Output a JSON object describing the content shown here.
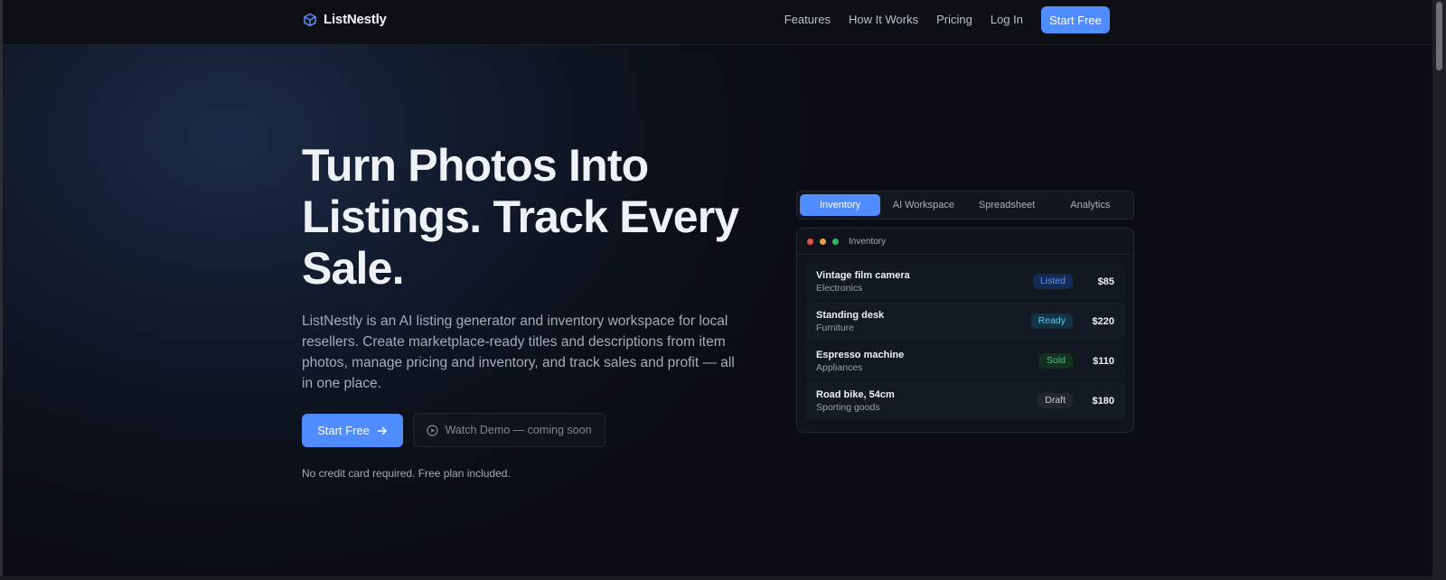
{
  "nav": {
    "brand": "ListNestly",
    "links": [
      "Features",
      "How It Works",
      "Pricing",
      "Log In"
    ],
    "cta": "Start Free"
  },
  "hero": {
    "title": "Turn Photos Into Listings. Track Every Sale.",
    "description": "ListNestly is an AI listing generator and inventory workspace for local resellers. Create marketplace-ready titles and descriptions from item photos, manage pricing and inventory, and track sales and profit — all in one place.",
    "primary_cta": "Start Free",
    "secondary_cta": "Watch Demo — coming soon",
    "note": "No credit card required. Free plan included."
  },
  "preview": {
    "tabs": [
      {
        "label": "Inventory",
        "active": true
      },
      {
        "label": "AI Workspace",
        "active": false
      },
      {
        "label": "Spreadsheet",
        "active": false
      },
      {
        "label": "Analytics",
        "active": false
      }
    ],
    "window_title": "Inventory",
    "items": [
      {
        "name": "Vintage film camera",
        "category": "Electronics",
        "status": "Listed",
        "price": "$85"
      },
      {
        "name": "Standing desk",
        "category": "Furniture",
        "status": "Ready",
        "price": "$220"
      },
      {
        "name": "Espresso machine",
        "category": "Appliances",
        "status": "Sold",
        "price": "$110"
      },
      {
        "name": "Road bike, 54cm",
        "category": "Sporting goods",
        "status": "Draft",
        "price": "$180"
      }
    ]
  },
  "colors": {
    "accent": "#4f8cff",
    "background": "#0b0e14",
    "status_listed": "#5c96ff",
    "status_ready": "#58c9f0",
    "status_sold": "#3fc777",
    "status_draft": "#c9ced6"
  },
  "icons": {
    "brand": "cube-icon",
    "primary_cta": "arrow-right-icon",
    "secondary_cta": "play-circle-icon"
  }
}
